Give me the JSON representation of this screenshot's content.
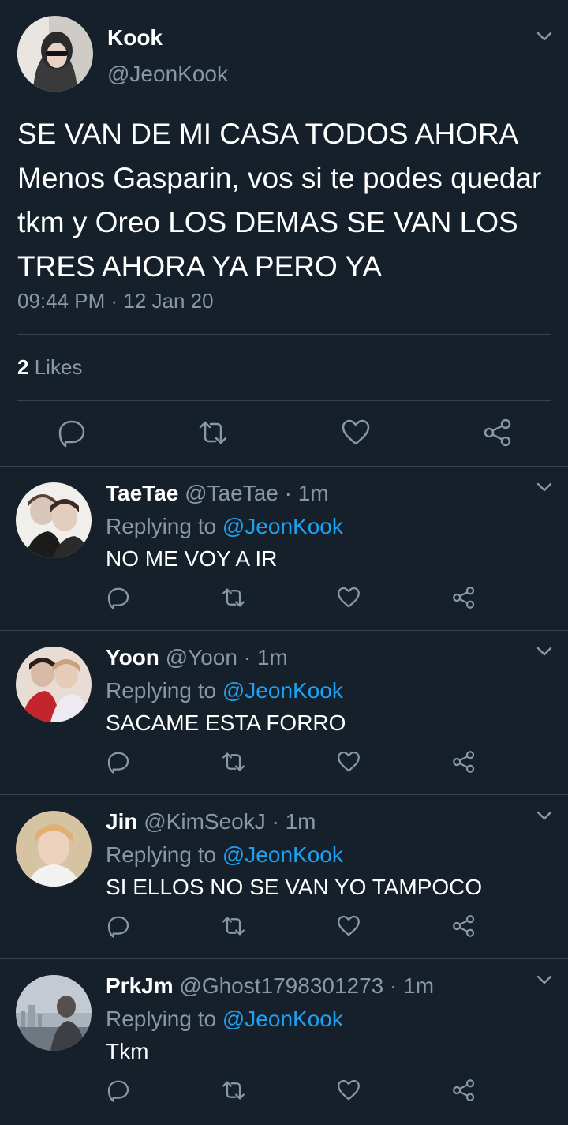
{
  "main_tweet": {
    "name": "Kook",
    "handle": "@JeonKook",
    "text": "SE VAN DE MI CASA TODOS AHORA Menos Gasparin, vos si te podes quedar tkm y Oreo LOS DEMAS SE VAN LOS TRES AHORA YA PERO YA",
    "timestamp": "09:44 PM · 12 Jan 20",
    "likes_count": "2",
    "likes_label": "Likes"
  },
  "replying_label": "Replying to",
  "replies": [
    {
      "name": "TaeTae",
      "handle": "@TaeTae",
      "time": " · 1m",
      "replying_to": "@JeonKook",
      "text": "NO ME VOY A IR"
    },
    {
      "name": "Yoon",
      "handle": "@Yoon",
      "time": " · 1m",
      "replying_to": "@JeonKook",
      "text": "SACAME ESTA FORRO"
    },
    {
      "name": "Jin",
      "handle": "@KimSeokJ",
      "time": " · 1m",
      "replying_to": "@JeonKook",
      "text": "SI ELLOS NO SE VAN YO TAMPOCO"
    },
    {
      "name": "PrkJm",
      "handle": "@Ghost1798301273",
      "time": " · 1m",
      "replying_to": "@JeonKook",
      "text": "Tkm"
    }
  ],
  "icons": {
    "reply": "reply-icon",
    "retweet": "retweet-icon",
    "like": "heart-icon",
    "share": "share-icon",
    "more": "chevron-down-icon"
  },
  "colors": {
    "background": "#15202b",
    "text": "#ffffff",
    "muted": "#8899a6",
    "accent": "#1da1f2",
    "divider": "#38444d"
  }
}
